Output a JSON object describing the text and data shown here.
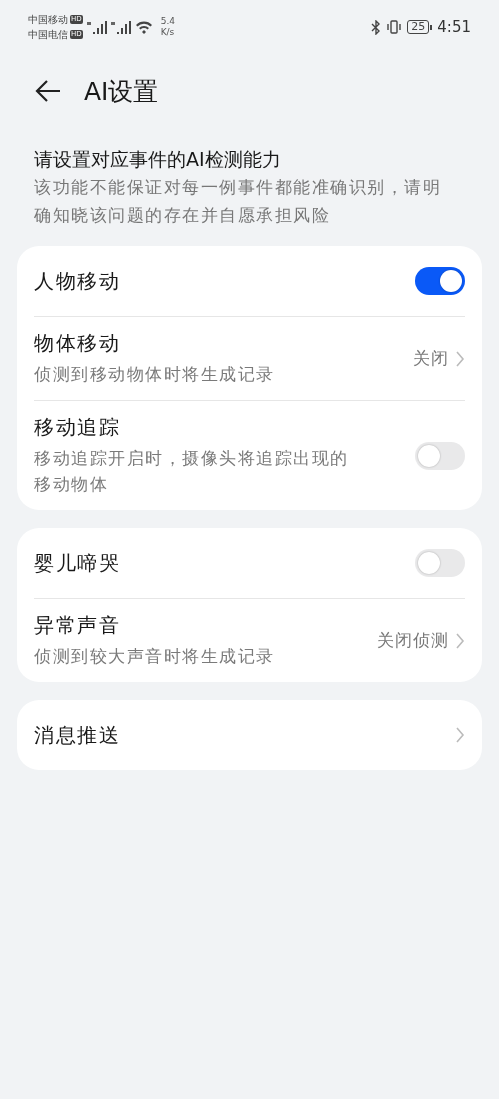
{
  "status_bar": {
    "carriers": [
      {
        "name": "中国移动",
        "badge": "HD"
      },
      {
        "name": "中国电信",
        "badge": "HD"
      }
    ],
    "speed_value": "5.4",
    "speed_unit": "K/s",
    "battery": "25",
    "time": "4:51"
  },
  "header": {
    "title": "AI设置"
  },
  "intro": {
    "heading": "请设置对应事件的AI检测能力",
    "text": "该功能不能保证对每一例事件都能准确识别，请明确知晓该问题的存在并自愿承担风险"
  },
  "groups": [
    {
      "rows": [
        {
          "kind": "toggle",
          "title": "人物移动",
          "on": true
        },
        {
          "kind": "value",
          "title": "物体移动",
          "subtitle": "侦测到移动物体时将生成记录",
          "value": "关闭"
        },
        {
          "kind": "toggle",
          "title": "移动追踪",
          "subtitle": "移动追踪开启时，摄像头将追踪出现的移动物体",
          "on": false
        }
      ]
    },
    {
      "rows": [
        {
          "kind": "toggle",
          "title": "婴儿啼哭",
          "on": false
        },
        {
          "kind": "value",
          "title": "异常声音",
          "subtitle": "侦测到较大声音时将生成记录",
          "value": "关闭侦测"
        }
      ]
    },
    {
      "rows": [
        {
          "kind": "link",
          "title": "消息推送"
        }
      ]
    }
  ]
}
